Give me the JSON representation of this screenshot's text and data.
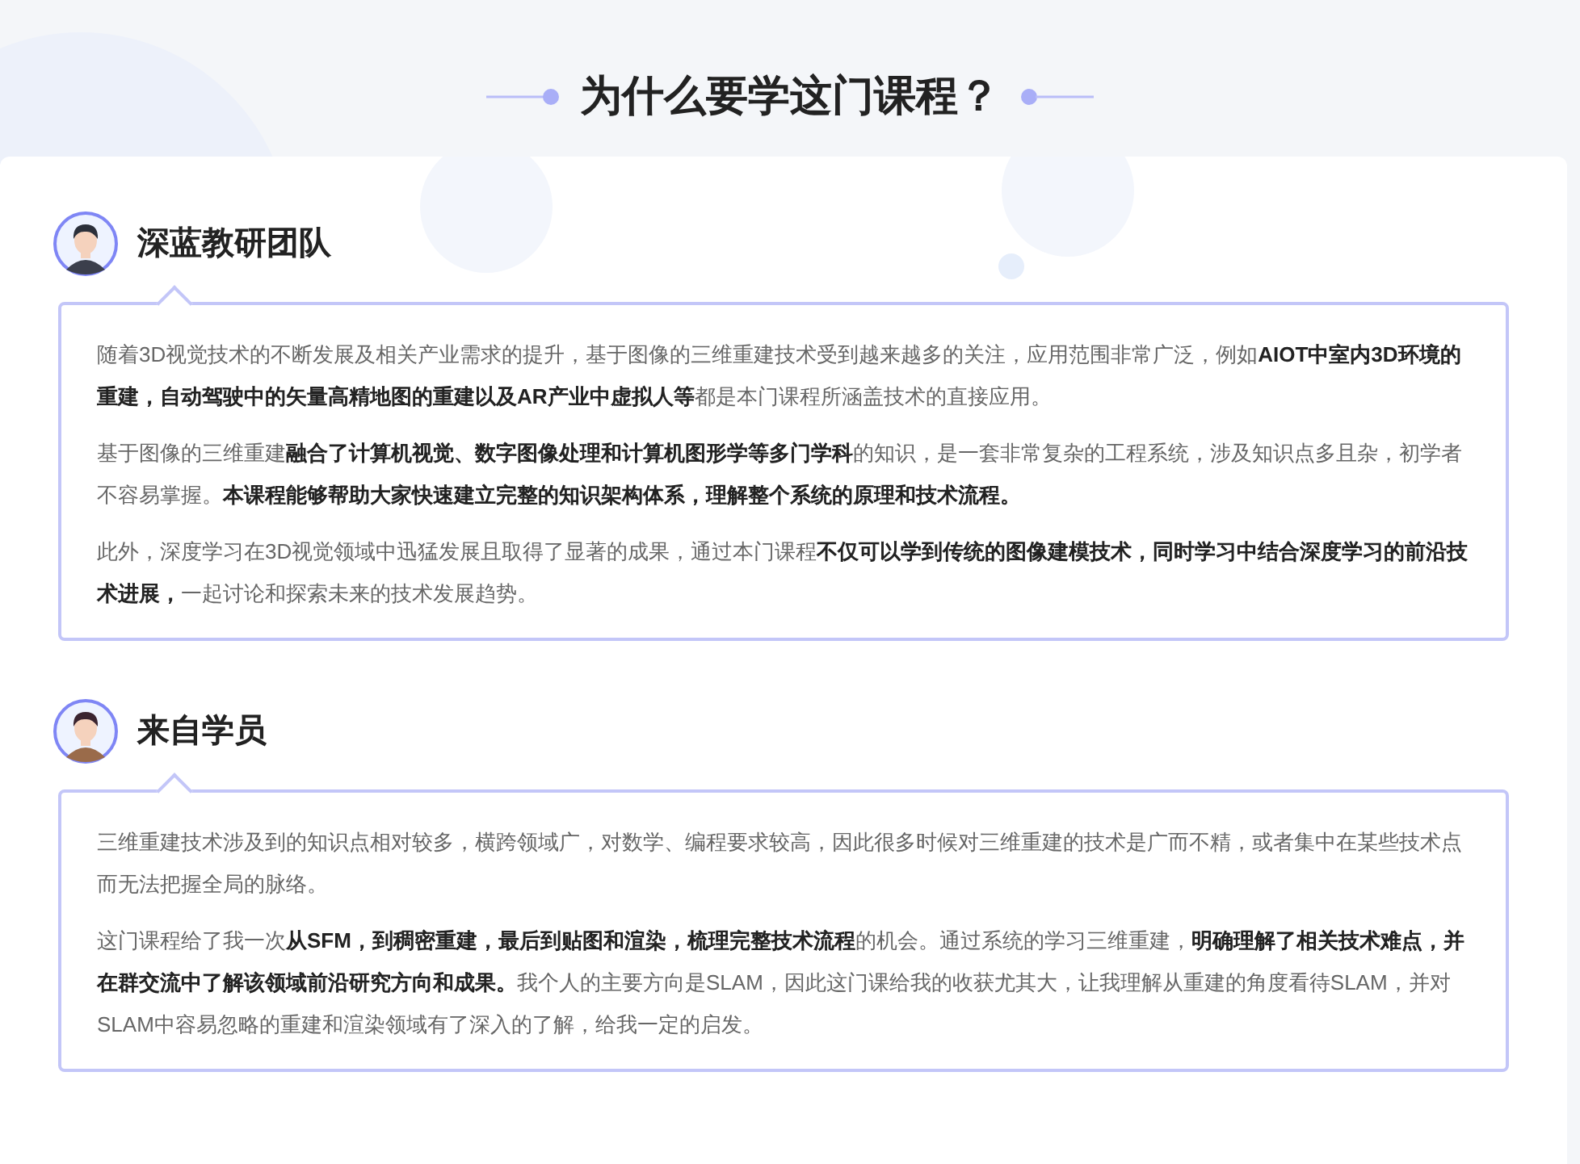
{
  "heading": "为什么要学这门课程？",
  "sections": [
    {
      "name": "深蓝教研团队",
      "kind": "teacher",
      "paragraphs": [
        "随着3D视觉技术的不断发展及相关产业需求的提升，基于图像的三维重建技术受到越来越多的关注，应用范围非常广泛，例如**AIOT中室内3D环境的重建，自动驾驶中的矢量高精地图的重建以及AR产业中虚拟人等**都是本门课程所涵盖技术的直接应用。",
        "基于图像的三维重建**融合了计算机视觉、数字图像处理和计算机图形学等多门学科**的知识，是一套非常复杂的工程系统，涉及知识点多且杂，初学者不容易掌握。**本课程能够帮助大家快速建立完整的知识架构体系，理解整个系统的原理和技术流程。**",
        "此外，深度学习在3D视觉领域中迅猛发展且取得了显著的成果，通过本门课程**不仅可以学到传统的图像建模技术，同时学习中结合深度学习的前沿技术进展，**一起讨论和探索未来的技术发展趋势。"
      ]
    },
    {
      "name": "来自学员",
      "kind": "student",
      "paragraphs": [
        "三维重建技术涉及到的知识点相对较多，横跨领域广，对数学、编程要求较高，因此很多时候对三维重建的技术是广而不精，或者集中在某些技术点而无法把握全局的脉络。",
        "这门课程给了我一次**从SFM，到稠密重建，最后到贴图和渲染，梳理完整技术流程**的机会。通过系统的学习三维重建，**明确理解了相关技术难点，并在群交流中了解该领域前沿研究方向和成果。**我个人的主要方向是SLAM，因此这门课给我的收获尤其大，让我理解从重建的角度看待SLAM，并对SLAM中容易忽略的重建和渲染领域有了深入的了解，给我一定的启发。"
      ]
    }
  ]
}
